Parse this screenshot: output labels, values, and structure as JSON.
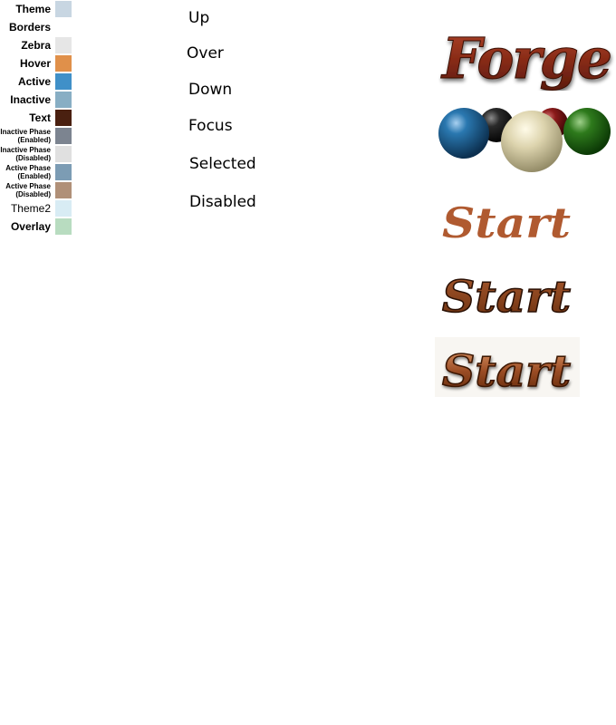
{
  "swatches": [
    {
      "label": "Theme",
      "color": "#c8d6e2"
    },
    {
      "label": "Borders",
      "color": null
    },
    {
      "label": "Zebra",
      "color": "#e6e6e6"
    },
    {
      "label": "Hover",
      "color": "#e0904a"
    },
    {
      "label": "Active",
      "color": "#4090c8"
    },
    {
      "label": "Inactive",
      "color": "#88aec4"
    },
    {
      "label": "Text",
      "color": "#4a2010"
    },
    {
      "label_lines": [
        "Inactive Phase",
        "(Enabled)"
      ],
      "color": "#7c8490"
    },
    {
      "label_lines": [
        "Inactive Phase",
        "(Disabled)"
      ],
      "color": "#e0e0e0"
    },
    {
      "label_lines": [
        "Active Phase",
        "(Enabled)"
      ],
      "color": "#7c9cb4"
    },
    {
      "label_lines": [
        "Active Phase",
        "(Disabled)"
      ],
      "color": "#b09078"
    },
    {
      "label": "Theme2",
      "color": "#d8ecf4"
    },
    {
      "label": "Overlay",
      "color": "#b8dcc0"
    }
  ],
  "states": [
    "Up",
    "Over",
    "Down",
    "Focus",
    "Selected",
    "Disabled"
  ],
  "logo": {
    "text": "Forge",
    "color": "#8a2c18"
  },
  "start_buttons": [
    {
      "text": "Start",
      "color": "#b05a30"
    },
    {
      "text": "Start",
      "color": "#8a4420"
    },
    {
      "text": "Start",
      "color": "#9a4c24"
    }
  ],
  "colors": {
    "ball_blue": "#1a5a8a",
    "ball_black": "#222222",
    "ball_red": "#7a1a1a",
    "ball_cream": "#d8d0a8",
    "ball_green": "#2a6a1a"
  }
}
